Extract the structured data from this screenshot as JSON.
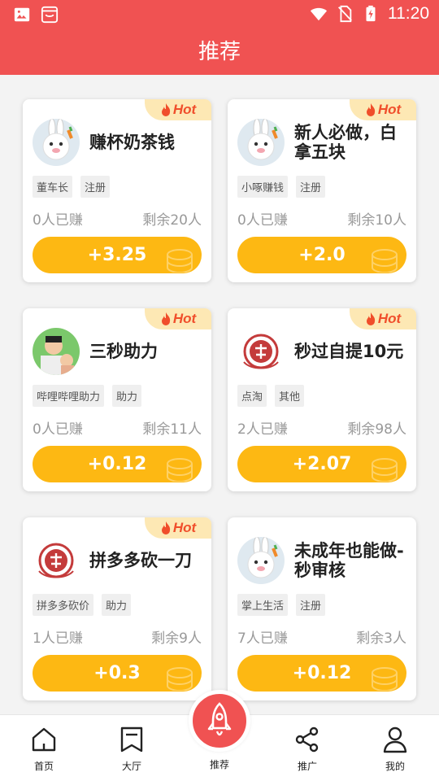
{
  "status_bar": {
    "time": "11:20",
    "icons": [
      "image-icon",
      "shopping-app-icon",
      "wifi-icon",
      "no-sim-icon",
      "battery-charging-icon"
    ]
  },
  "header": {
    "title": "推荐"
  },
  "hot_label": "Hot",
  "cards": [
    {
      "title": "赚杯奶茶钱",
      "avatar": "bunny-avatar",
      "tags": [
        "董车长",
        "注册"
      ],
      "earned": "0人已赚",
      "remaining": "剩余20人",
      "reward": "+3.25",
      "hot": true
    },
    {
      "title": "新人必做，白拿五块",
      "avatar": "bunny-avatar",
      "tags": [
        "小啄赚钱",
        "注册"
      ],
      "earned": "0人已赚",
      "remaining": "剩余10人",
      "reward": "+2.0",
      "hot": true
    },
    {
      "title": "三秒助力",
      "avatar": "photo-avatar",
      "tags": [
        "哔哩哔哩助力",
        "助力"
      ],
      "earned": "0人已赚",
      "remaining": "剩余11人",
      "reward": "+0.12",
      "hot": true
    },
    {
      "title": "秒过自提10元",
      "avatar": "seal-avatar",
      "tags": [
        "点淘",
        "其他"
      ],
      "earned": "2人已赚",
      "remaining": "剩余98人",
      "reward": "+2.07",
      "hot": true
    },
    {
      "title": "拼多多砍一刀",
      "avatar": "seal-avatar",
      "tags": [
        "拼多多砍价",
        "助力"
      ],
      "earned": "1人已赚",
      "remaining": "剩余9人",
      "reward": "+0.3",
      "hot": true
    },
    {
      "title": "未成年也能做-秒审核",
      "avatar": "bunny-avatar",
      "tags": [
        "掌上生活",
        "注册"
      ],
      "earned": "7人已赚",
      "remaining": "剩余3人",
      "reward": "+0.12",
      "hot": false
    }
  ],
  "colors": {
    "header": "#f05252",
    "reward_button": "#fdb813",
    "hot_text": "#f04e2b",
    "hot_bg": "#fde8b4"
  },
  "navbar": {
    "items": [
      {
        "label": "首页",
        "icon": "home-icon"
      },
      {
        "label": "大厅",
        "icon": "hall-icon"
      },
      {
        "label": "推荐",
        "icon": "rocket-icon"
      },
      {
        "label": "推广",
        "icon": "share-icon"
      },
      {
        "label": "我的",
        "icon": "user-icon"
      }
    ]
  }
}
